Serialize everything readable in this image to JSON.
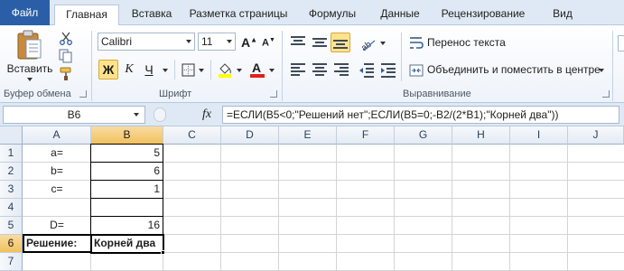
{
  "tabs": [
    "Файл",
    "Главная",
    "Вставка",
    "Разметка страницы",
    "Формулы",
    "Данные",
    "Рецензирование",
    "Вид"
  ],
  "ribbon": {
    "clipboard": {
      "paste_label": "Вставить",
      "group_label": "Буфер обмена"
    },
    "font": {
      "name": "Calibri",
      "size": "11",
      "bold": "Ж",
      "italic": "К",
      "underline": "Ч",
      "font_color_letter": "A",
      "highlight_color": "#ffff00",
      "font_color": "#e0201b",
      "group_label": "Шрифт"
    },
    "alignment": {
      "wrap_text": "Перенос текста",
      "merge_center": "Объединить и поместить в центре",
      "group_label": "Выравнивание"
    }
  },
  "formula_bar": {
    "name_box": "B6",
    "fx": "fx",
    "formula": "=ЕСЛИ(B5<0;\"Решений нет\";ЕСЛИ(B5=0;-B2/(2*B1);\"Корней два\"))"
  },
  "sheet": {
    "columns": [
      "A",
      "B",
      "C",
      "D",
      "E",
      "F",
      "G",
      "H",
      "I",
      "J"
    ],
    "rows": [
      "1",
      "2",
      "3",
      "4",
      "5",
      "6",
      "7"
    ],
    "cells": {
      "A1": "a=",
      "B1": "5",
      "A2": "b=",
      "B2": "6",
      "A3": "c=",
      "B3": "1",
      "A5": "D=",
      "B5": "16",
      "A6": "Решение:",
      "B6": "Корней два"
    },
    "selected_cell": "B6"
  }
}
